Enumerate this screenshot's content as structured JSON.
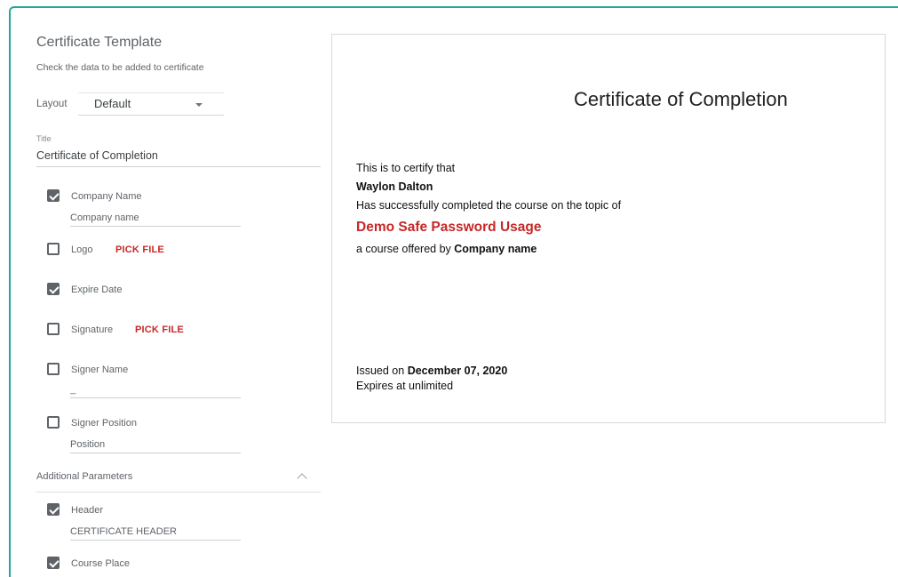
{
  "panel": {
    "title": "Certificate Template",
    "subtitle": "Check the data to be added to certificate",
    "layout_label": "Layout",
    "layout_value": "Default",
    "title_field_label": "Title",
    "title_field_value": "Certificate of Completion"
  },
  "options": {
    "company_name": {
      "label": "Company Name",
      "checked": true,
      "value": "Company name"
    },
    "logo": {
      "label": "Logo",
      "checked": false,
      "action": "PICK FILE"
    },
    "expire_date": {
      "label": "Expire Date",
      "checked": true
    },
    "signature": {
      "label": "Signature",
      "checked": false,
      "action": "PICK FILE"
    },
    "signer_name": {
      "label": "Signer Name",
      "checked": false,
      "value": "_"
    },
    "signer_position": {
      "label": "Signer Position",
      "checked": false,
      "value": "Position"
    }
  },
  "additional": {
    "label": "Additional Parameters",
    "header": {
      "label": "Header",
      "checked": true,
      "value": "CERTIFICATE HEADER"
    },
    "course_place": {
      "label": "Course Place",
      "checked": true
    }
  },
  "certificate": {
    "title": "Certificate of Completion",
    "certify_text": "This is to certify that",
    "recipient": "Waylon Dalton",
    "completed_text": "Has successfully completed the course on the topic of",
    "course": "Demo Safe Password Usage",
    "offered_prefix": "a course offered by",
    "company": "Company name",
    "issued_prefix": "Issued on",
    "issued_date": "December 07, 2020",
    "expires_text": "Expires at unlimited"
  },
  "colors": {
    "accent": "#c62828",
    "frame": "#26a69a"
  }
}
